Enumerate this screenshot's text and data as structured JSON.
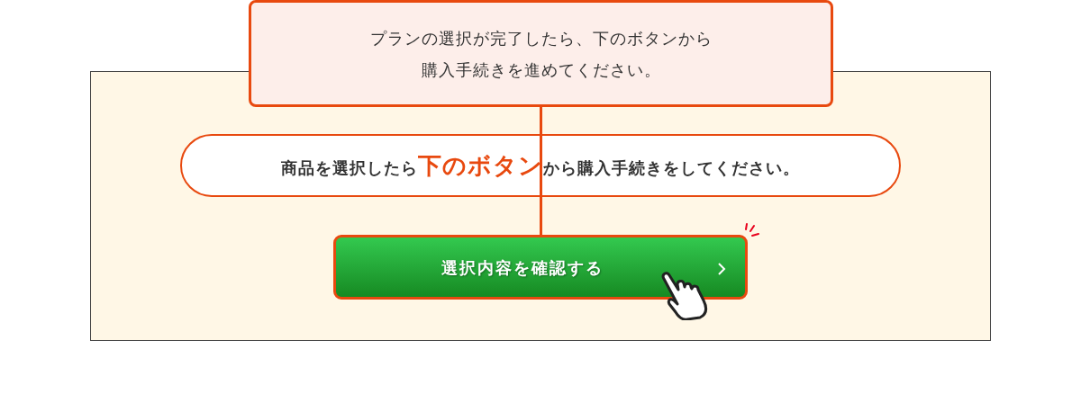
{
  "callout": {
    "lines": [
      "プランの選択が完了したら、下のボタンから",
      "購入手続きを進めてください。"
    ]
  },
  "notice": {
    "segments": [
      {
        "kind": "plain",
        "text": "商品を選択したら"
      },
      {
        "kind": "emphasis",
        "text": "下のボタン"
      },
      {
        "kind": "plain",
        "text": "から購入手続きをしてください。"
      }
    ]
  },
  "confirm_button": {
    "label": "選択内容を確認する"
  }
}
